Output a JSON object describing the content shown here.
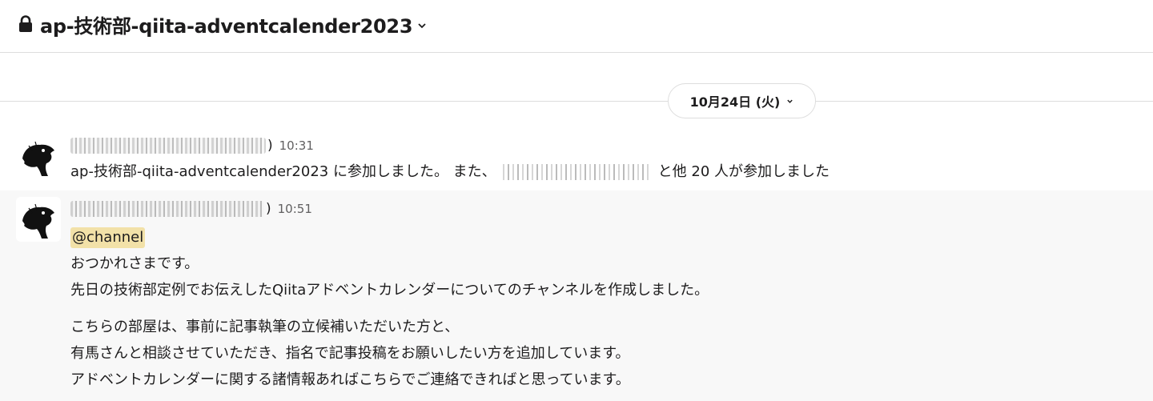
{
  "channel": {
    "name": "ap-技術部-qiita-adventcalender2023"
  },
  "date_divider": {
    "label": "10月24日 (火)"
  },
  "messages": [
    {
      "time": "10:31",
      "paren_close": ")",
      "join_prefix": "ap-技術部-qiita-adventcalender2023 に参加しました。 また、",
      "join_suffix": "と他 20 人が参加しました"
    },
    {
      "time": "10:51",
      "paren_close": ")",
      "mention": "@channel",
      "lines": [
        "おつかれさまです。",
        "先日の技術部定例でお伝えしたQiitaアドベントカレンダーについてのチャンネルを作成しました。",
        "こちらの部屋は、事前に記事執筆の立候補いただいた方と、",
        "有馬さんと相談させていただき、指名で記事投稿をお願いしたい方を追加しています。",
        "アドベントカレンダーに関する諸情報あればこちらでご連絡できればと思っています。"
      ]
    }
  ],
  "colors": {
    "mention_bg": "#f2e1a8",
    "timestamp": "#616061",
    "divider": "#dddddd",
    "highlight_row": "#f8f8f8"
  },
  "icons": [
    "lock-icon",
    "chevron-down-icon"
  ]
}
